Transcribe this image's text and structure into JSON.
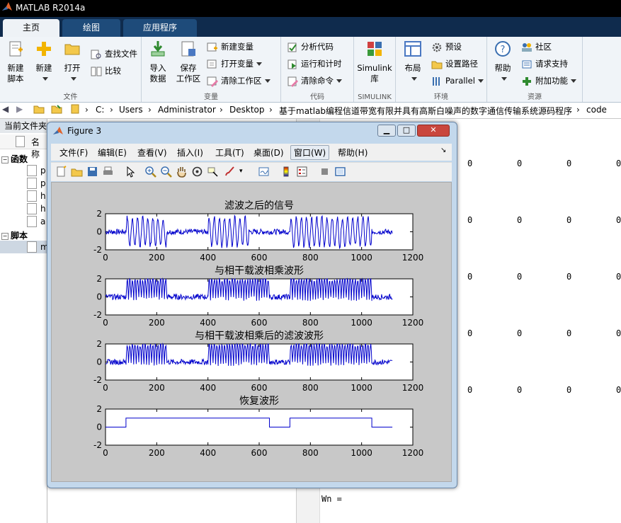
{
  "app_title": "MATLAB R2014a",
  "tabs": [
    {
      "label": "主页",
      "active": true
    },
    {
      "label": "绘图",
      "active": false
    },
    {
      "label": "应用程序",
      "active": false
    }
  ],
  "ribbon": {
    "file": {
      "label": "文件",
      "new_script": "新建\n脚本",
      "new": "新建",
      "open": "打开",
      "find_files": "查找文件",
      "compare": "比较"
    },
    "variable": {
      "label": "变量",
      "import": "导入\n数据",
      "save_ws": "保存\n工作区",
      "new_var": "新建变量",
      "open_var": "打开变量",
      "clear_ws": "清除工作区"
    },
    "code": {
      "label": "代码",
      "analyze": "分析代码",
      "run_time": "运行和计时",
      "clear_cmd": "清除命令"
    },
    "simulink": {
      "label": "SIMULINK",
      "lib": "Simulink\n库"
    },
    "env": {
      "label": "环境",
      "layout": "布局",
      "prefs": "预设",
      "set_path": "设置路径",
      "parallel": "Parallel"
    },
    "resources": {
      "label": "资源",
      "help": "帮助",
      "community": "社区",
      "support": "请求支持",
      "addons": "附加功能"
    }
  },
  "address": {
    "path": [
      "C:",
      "Users",
      "Administrator",
      "Desktop",
      "基于matlab编程信道带宽有限并具有高斯白噪声的数字通信传输系统源码程序",
      "code"
    ]
  },
  "left": {
    "header": "当前文件夹",
    "col_name": "名称",
    "groups": [
      {
        "label": "函数"
      },
      {
        "label": "脚本"
      }
    ],
    "files": [
      {
        "name": "p"
      },
      {
        "name": "p"
      },
      {
        "name": "h"
      },
      {
        "name": "h"
      },
      {
        "name": "a"
      },
      {
        "name": "m"
      }
    ]
  },
  "command": {
    "zeros": "0",
    "wn": "Wn ="
  },
  "figure": {
    "title": "Figure 3",
    "menus": [
      "文件(F)",
      "编辑(E)",
      "查看(V)",
      "插入(I)",
      "工具(T)",
      "桌面(D)",
      "窗口(W)",
      "帮助(H)"
    ],
    "selected_menu": "窗口(W)"
  },
  "colors": {
    "plot_line": "#0000cc",
    "ribbon_bg": "#f0f4f8",
    "tab_bar": "#0f2b4d"
  },
  "chart_data": [
    {
      "type": "line",
      "title": "滤波之后的信号",
      "xlim": [
        0,
        1200
      ],
      "ylim": [
        -2,
        2
      ],
      "xticks": [
        "0",
        "200",
        "400",
        "600",
        "800",
        "1000",
        "1200"
      ],
      "yticks": [
        "2",
        "0",
        "-2"
      ],
      "series": [
        {
          "segments": [
            {
              "x": [
                0,
                80
              ],
              "kind": "noise"
            },
            {
              "x": [
                80,
                240
              ],
              "kind": "osc"
            },
            {
              "x": [
                240,
                400
              ],
              "kind": "noise"
            },
            {
              "x": [
                400,
                560
              ],
              "kind": "osc"
            },
            {
              "x": [
                560,
                720
              ],
              "kind": "noise"
            },
            {
              "x": [
                720,
                1040
              ],
              "kind": "osc"
            },
            {
              "x": [
                1040,
                1120
              ],
              "kind": "noise"
            }
          ]
        }
      ]
    },
    {
      "type": "line",
      "title": "与相干载波相乘波形",
      "xlim": [
        0,
        1200
      ],
      "ylim": [
        -2,
        2
      ],
      "xticks": [
        "0",
        "200",
        "400",
        "600",
        "800",
        "1000",
        "1200"
      ],
      "yticks": [
        "2",
        "0",
        "-2"
      ],
      "series": [
        {
          "segments": [
            {
              "x": [
                0,
                80
              ],
              "kind": "noise"
            },
            {
              "x": [
                80,
                240
              ],
              "kind": "rect"
            },
            {
              "x": [
                240,
                400
              ],
              "kind": "noise"
            },
            {
              "x": [
                400,
                640
              ],
              "kind": "rect"
            },
            {
              "x": [
                640,
                720
              ],
              "kind": "noise"
            },
            {
              "x": [
                720,
                1040
              ],
              "kind": "rect"
            },
            {
              "x": [
                1040,
                1120
              ],
              "kind": "noise"
            }
          ]
        }
      ]
    },
    {
      "type": "line",
      "title": "与相干载波相乘后的滤波波形",
      "xlim": [
        0,
        1200
      ],
      "ylim": [
        -2,
        2
      ],
      "xticks": [
        "0",
        "200",
        "400",
        "600",
        "800",
        "1000",
        "1200"
      ],
      "yticks": [
        "2",
        "0",
        "-2"
      ],
      "series": [
        {
          "segments": [
            {
              "x": [
                0,
                80
              ],
              "kind": "noise"
            },
            {
              "x": [
                80,
                240
              ],
              "kind": "rect"
            },
            {
              "x": [
                240,
                400
              ],
              "kind": "noise"
            },
            {
              "x": [
                400,
                640
              ],
              "kind": "rect"
            },
            {
              "x": [
                640,
                720
              ],
              "kind": "noise"
            },
            {
              "x": [
                720,
                1040
              ],
              "kind": "rect"
            },
            {
              "x": [
                1040,
                1120
              ],
              "kind": "noise"
            }
          ]
        }
      ]
    },
    {
      "type": "line",
      "title": "恢复波形",
      "xlim": [
        0,
        1200
      ],
      "ylim": [
        -2,
        2
      ],
      "xticks": [
        "0",
        "200",
        "400",
        "600",
        "800",
        "1000",
        "1200"
      ],
      "yticks": [
        "2",
        "0",
        "-2"
      ],
      "series": [
        {
          "x": [
            0,
            80,
            80,
            640,
            640,
            720,
            720,
            1040,
            1040,
            1120
          ],
          "y": [
            0,
            0,
            1,
            1,
            0,
            0,
            1,
            1,
            0,
            0
          ]
        }
      ]
    }
  ]
}
